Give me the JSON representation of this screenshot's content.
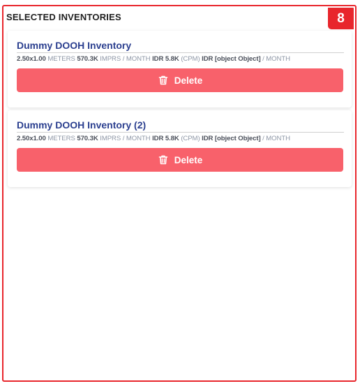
{
  "panel": {
    "title": "SELECTED INVENTORIES",
    "count": "8"
  },
  "inventories": [
    {
      "name": "Dummy DOOH Inventory",
      "size": "2.50x1.00",
      "size_unit": "METERS",
      "impressions": "570.3K",
      "impressions_unit": "IMPRS / MONTH",
      "cpm": "IDR 5.8K",
      "cpm_unit": "(CPM)",
      "price": "IDR [object Object]",
      "price_unit": "/ MONTH",
      "delete_label": "Delete"
    },
    {
      "name": "Dummy DOOH Inventory (2)",
      "size": "2.50x1.00",
      "size_unit": "METERS",
      "impressions": "570.3K",
      "impressions_unit": "IMPRS / MONTH",
      "cpm": "IDR 5.8K",
      "cpm_unit": "(CPM)",
      "price": "IDR [object Object]",
      "price_unit": "/ MONTH",
      "delete_label": "Delete"
    }
  ],
  "colors": {
    "accent": "#e8262c",
    "delete_button": "#f8616b",
    "title_blue": "#2b3f8f"
  },
  "icons": {
    "delete": "trash-icon"
  }
}
